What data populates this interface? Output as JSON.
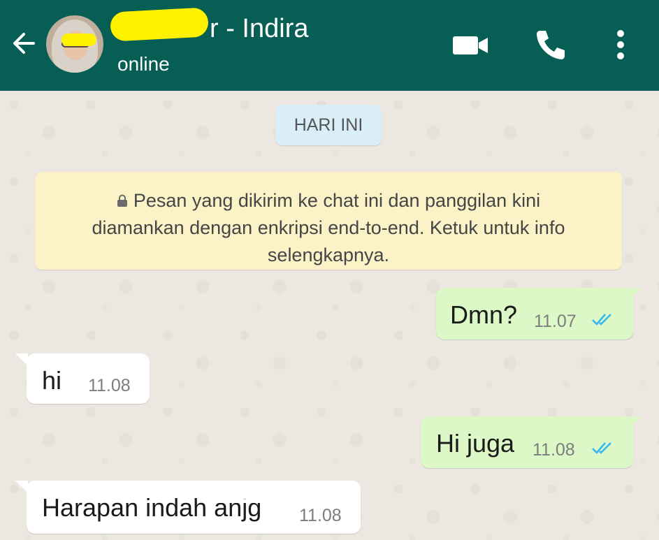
{
  "header": {
    "title_suffix": "r - Indira",
    "status": "online",
    "bg_color": "#075e54"
  },
  "icons": {
    "back": "arrow-left-icon",
    "video": "videocam-icon",
    "call": "phone-icon",
    "menu": "more-vertical-icon",
    "lock": "lock-icon",
    "read_receipt": "double-check-icon"
  },
  "chat": {
    "date_chip": "HARI INI",
    "notice": {
      "line1": "Pesan yang dikirim ke chat ini dan panggilan kini",
      "line2": "diamankan dengan enkripsi end-to-end. Ketuk untuk info",
      "line3": "selengkapnya."
    },
    "messages": [
      {
        "direction": "out",
        "text": "Dmn?",
        "time": "11.07",
        "read": true
      },
      {
        "direction": "in",
        "text": "hi",
        "time": "11.08"
      },
      {
        "direction": "out",
        "text": "Hi juga",
        "time": "11.08",
        "read": true
      },
      {
        "direction": "in",
        "text": "Harapan indah anjg",
        "time": "11.08"
      }
    ]
  },
  "colors": {
    "outgoing_bubble": "#dcf8c6",
    "incoming_bubble": "#ffffff",
    "notice_bg": "#fbf3c7",
    "date_chip_bg": "#d9eef8",
    "tick_blue": "#34b7f1"
  }
}
